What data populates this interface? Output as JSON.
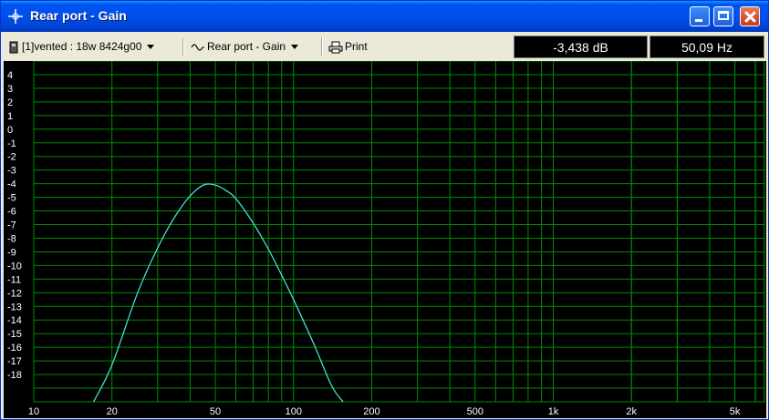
{
  "window": {
    "title": "Rear port - Gain"
  },
  "toolbar": {
    "driver_select": "[1]vented : 18w 8424g00",
    "graph_select": "Rear port - Gain",
    "print_label": "Print",
    "readout_db": "-3,438 dB",
    "readout_hz": "50,09 Hz"
  },
  "colors": {
    "grid": "#008c00",
    "curve": "#40e0d0",
    "background": "#000000"
  },
  "chart_data": {
    "type": "line",
    "x_scale": "log",
    "xlim": [
      10,
      6500
    ],
    "ylim": [
      -20,
      5
    ],
    "x_tick_labels": [
      "10",
      "20",
      "50",
      "100",
      "200",
      "500",
      "1k",
      "2k",
      "5k"
    ],
    "x_tick_values": [
      10,
      20,
      50,
      100,
      200,
      500,
      1000,
      2000,
      5000
    ],
    "y_tick_labels": [
      "4",
      "3",
      "2",
      "1",
      "0",
      "-1",
      "-2",
      "-3",
      "-4",
      "-5",
      "-6",
      "-7",
      "-8",
      "-9",
      "-10",
      "-11",
      "-12",
      "-13",
      "-14",
      "-15",
      "-16",
      "-17",
      "-18"
    ],
    "y_tick_values": [
      4,
      3,
      2,
      1,
      0,
      -1,
      -2,
      -3,
      -4,
      -5,
      -6,
      -7,
      -8,
      -9,
      -10,
      -11,
      -12,
      -13,
      -14,
      -15,
      -16,
      -17,
      -18
    ],
    "grid": true,
    "series": [
      {
        "x": [
          17,
          20,
          25,
          30,
          35,
          40,
          45,
          50,
          55,
          60,
          70,
          80,
          90,
          100,
          120,
          140,
          155
        ],
        "y": [
          -20,
          -17.3,
          -12.1,
          -8.7,
          -6.4,
          -4.9,
          -4.1,
          -4.1,
          -4.5,
          -5.1,
          -6.9,
          -8.8,
          -10.7,
          -12.5,
          -15.8,
          -18.8,
          -20
        ]
      }
    ]
  }
}
